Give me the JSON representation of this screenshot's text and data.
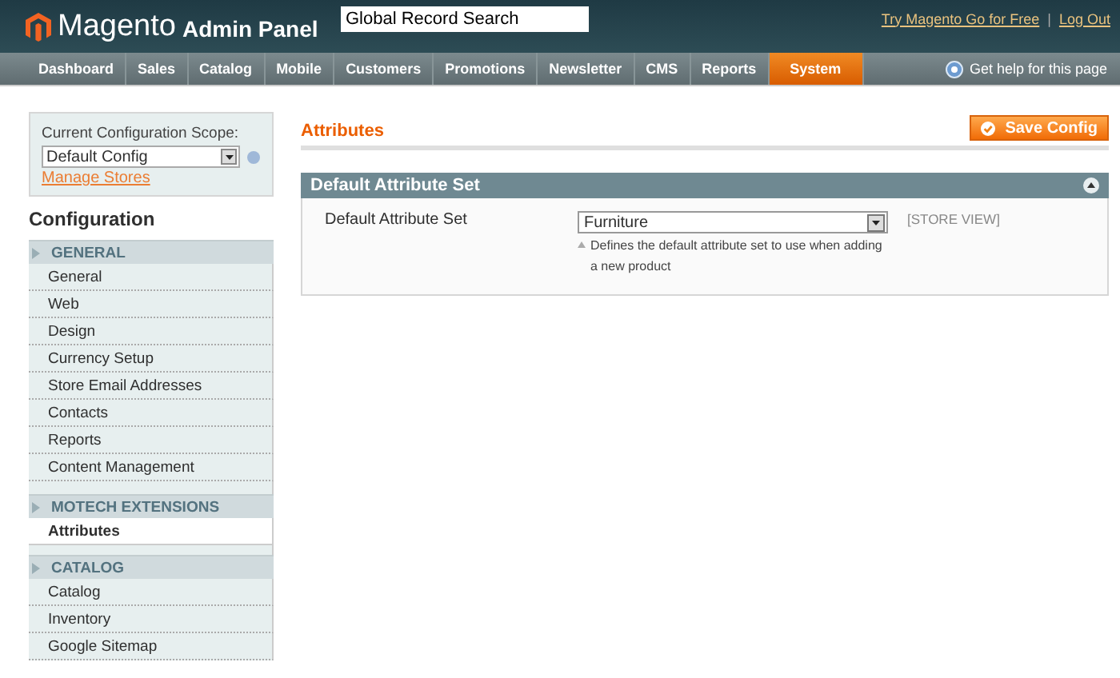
{
  "header": {
    "logo": "Magento",
    "logo_suffix": "Admin Panel",
    "search": {
      "value": "Global Record Search"
    },
    "links": [
      "Try Magento Go for Free",
      "Log Out"
    ],
    "separator": "|"
  },
  "nav": {
    "items": [
      {
        "label": "Dashboard",
        "selected": false
      },
      {
        "label": "Sales",
        "selected": false
      },
      {
        "label": "Catalog",
        "selected": false
      },
      {
        "label": "Mobile",
        "selected": false
      },
      {
        "label": "Customers",
        "selected": false
      },
      {
        "label": "Promotions",
        "selected": false
      },
      {
        "label": "Newsletter",
        "selected": false
      },
      {
        "label": "CMS",
        "selected": false
      },
      {
        "label": "Reports",
        "selected": false
      },
      {
        "label": "System",
        "selected": true
      }
    ],
    "help": "Get help for this page"
  },
  "sidebar": {
    "scope_label": "Current Configuration Scope:",
    "scope_value": "Default Config",
    "manage_link": "Manage Stores",
    "title": "Configuration",
    "sections": [
      {
        "label": "GENERAL",
        "items": [
          {
            "label": "General",
            "selected": false
          },
          {
            "label": "Web",
            "selected": false
          },
          {
            "label": "Design",
            "selected": false
          },
          {
            "label": "Currency Setup",
            "selected": false
          },
          {
            "label": "Store Email Addresses",
            "selected": false
          },
          {
            "label": "Contacts",
            "selected": false
          },
          {
            "label": "Reports",
            "selected": false
          },
          {
            "label": "Content Management",
            "selected": false
          }
        ]
      },
      {
        "label": "MOTECH EXTENSIONS",
        "items": [
          {
            "label": "Attributes",
            "selected": true
          }
        ]
      },
      {
        "label": "CATALOG",
        "items": [
          {
            "label": "Catalog",
            "selected": false
          },
          {
            "label": "Inventory",
            "selected": false
          },
          {
            "label": "Google Sitemap",
            "selected": false
          }
        ]
      }
    ]
  },
  "content": {
    "title": "Attributes",
    "save_button": "Save Config",
    "fieldset": {
      "title": "Default Attribute Set",
      "expanded": true,
      "rows": [
        {
          "label": "Default Attribute Set",
          "value": "Furniture",
          "note": "Defines the default attribute set to use when adding a new product",
          "scope": "[STORE VIEW]"
        }
      ]
    }
  }
}
